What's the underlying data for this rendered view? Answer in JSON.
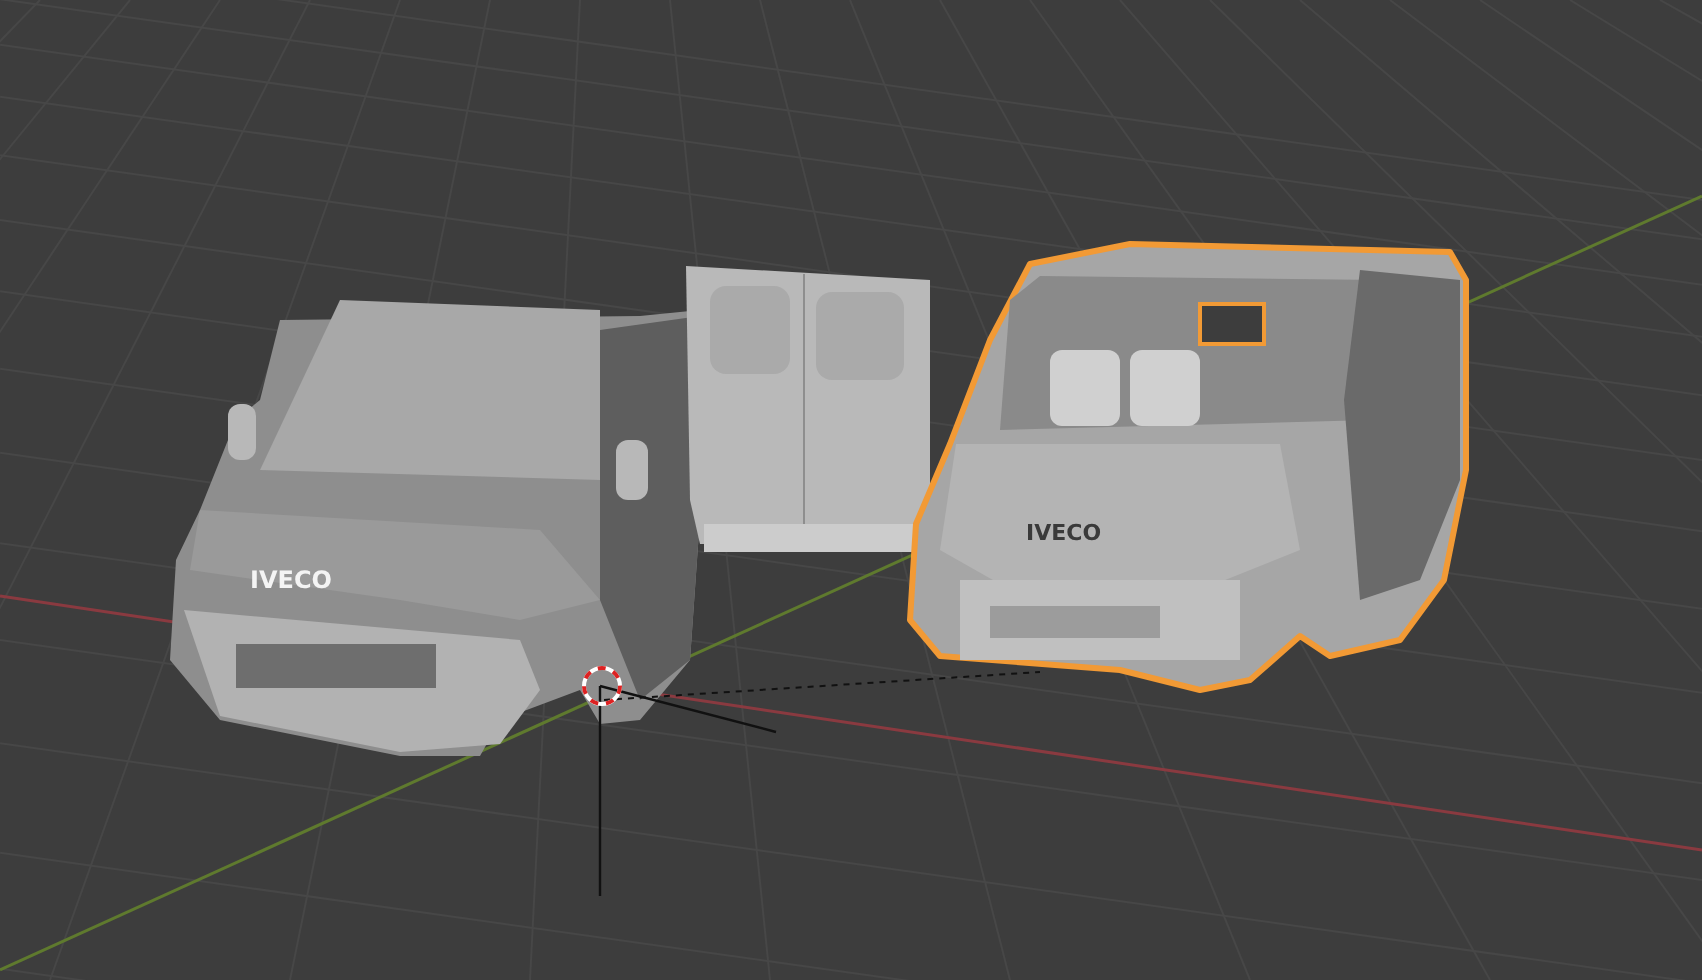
{
  "viewport": {
    "models": [
      {
        "kind": "cab",
        "selected": false,
        "badge": "IVECO"
      },
      {
        "kind": "doors",
        "selected": false
      },
      {
        "kind": "van",
        "selected": true,
        "badge": "IVECO"
      }
    ]
  }
}
